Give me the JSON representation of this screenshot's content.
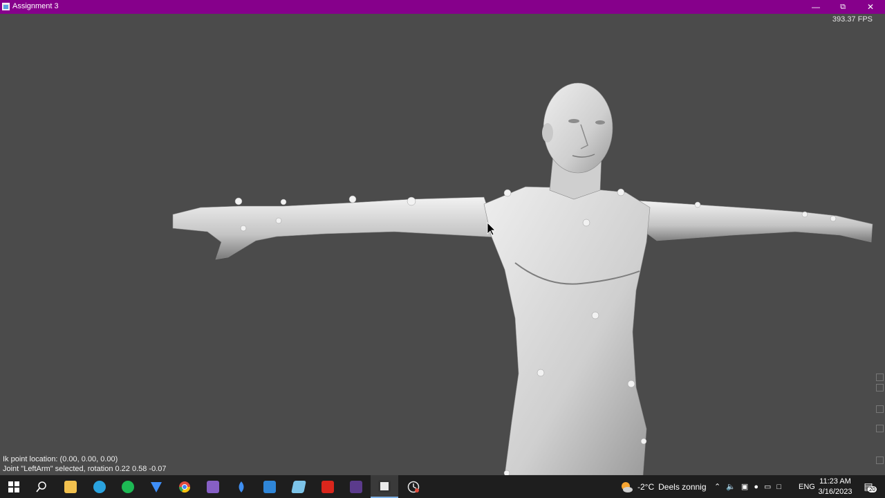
{
  "window": {
    "title": "Assignment 3",
    "minimize_icon": "minimize-icon",
    "restore_icon": "restore-icon",
    "close_icon": "close-icon"
  },
  "viewport": {
    "fps": "393.37 FPS",
    "status_line_1": "Ik point location: (0.00, 0.00, 0.00)",
    "status_line_2": "Joint \"LeftArm\" selected, rotation 0.22 0.58 -0.07",
    "background_color": "#4b4b4b",
    "model_color": "#d8d8d8",
    "joint_marker_color": "#f2f2f2"
  },
  "taskbar": {
    "apps": [
      {
        "name": "windows-start-icon",
        "color": "#ffffff"
      },
      {
        "name": "search-icon",
        "color": "#ffffff"
      },
      {
        "name": "file-explorer-icon",
        "color": "#f2c14e"
      },
      {
        "name": "telegram-icon",
        "color": "#2aa3df"
      },
      {
        "name": "spotify-icon",
        "color": "#1db954"
      },
      {
        "name": "vpn-app-icon",
        "color": "#3e8ef7"
      },
      {
        "name": "chrome-icon",
        "color": "#e04a3c"
      },
      {
        "name": "visual-studio-icon",
        "color": "#865fc5"
      },
      {
        "name": "color-picker-icon",
        "color": "#3f8ff2"
      },
      {
        "name": "calculator-icon",
        "color": "#2f86d8"
      },
      {
        "name": "notes-app-icon",
        "color": "#7cc3e8"
      },
      {
        "name": "acrobat-icon",
        "color": "#d9261c"
      },
      {
        "name": "terminal-icon",
        "color": "#5b3b8c"
      },
      {
        "name": "assignment-app-icon",
        "color": "#e8e8e8"
      },
      {
        "name": "clock-app-icon",
        "color": "#e8e8e8"
      }
    ],
    "weather": {
      "icon": "partly-sunny-icon",
      "temp": "-2°C",
      "desc": "Deels zonnig"
    },
    "language": "ENG",
    "time": "11:23 AM",
    "date": "3/16/2023",
    "notifications": "20"
  }
}
